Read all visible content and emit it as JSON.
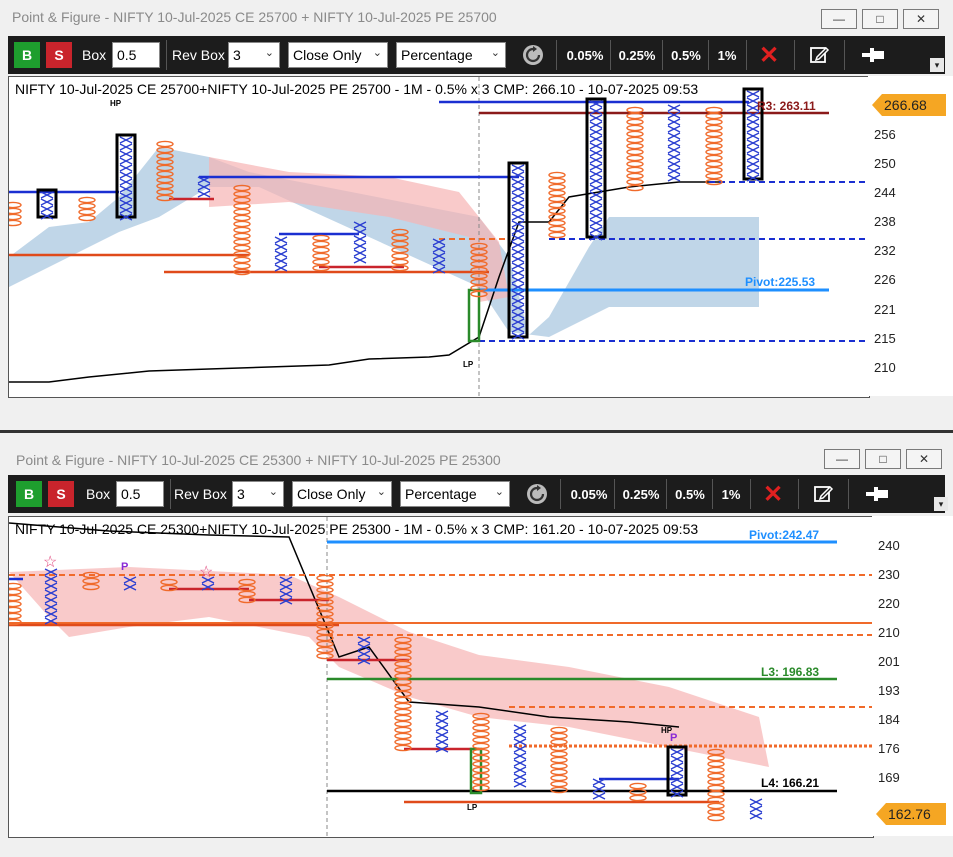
{
  "windows": [
    {
      "title": "Point & Figure - NIFTY 10-Jul-2025 CE 25700 + NIFTY 10-Jul-2025 PE 25700",
      "toolbar": {
        "buy": "B",
        "sell": "S",
        "box_label": "Box",
        "box_value": "0.5",
        "rev_label": "Rev Box",
        "rev_value": "3",
        "mode": "Close Only",
        "method": "Percentage",
        "pcts": [
          "0.05%",
          "0.25%",
          "0.5%",
          "1%"
        ]
      },
      "caption": "NIFTY 10-Jul-2025 CE 25700+NIFTY 10-Jul-2025 PE 25700 - 1M - 0.5% x 3 CMP: 266.10 - 10-07-2025 09:53",
      "cmp_tag": "266.68",
      "ticks": [
        "256",
        "250",
        "244",
        "238",
        "232",
        "226",
        "221",
        "215",
        "210"
      ],
      "levels": {
        "r3": "R3: 263.11",
        "pivot": "Pivot:225.53"
      },
      "markers": {
        "hp": "HP",
        "lp": "LP"
      }
    },
    {
      "title": "Point & Figure - NIFTY 10-Jul-2025 CE 25300 + NIFTY 10-Jul-2025 PE 25300",
      "toolbar": {
        "buy": "B",
        "sell": "S",
        "box_label": "Box",
        "box_value": "0.5",
        "rev_label": "Rev Box",
        "rev_value": "3",
        "mode": "Close Only",
        "method": "Percentage",
        "pcts": [
          "0.05%",
          "0.25%",
          "0.5%",
          "1%"
        ]
      },
      "caption": "NIFTY 10-Jul-2025 CE 25300+NIFTY 10-Jul-2025 PE 25300 - 1M - 0.5% x 3 CMP: 161.20 - 10-07-2025 09:53",
      "cmp_tag": "162.76",
      "ticks": [
        "240",
        "230",
        "220",
        "210",
        "201",
        "193",
        "184",
        "176",
        "169"
      ],
      "levels": {
        "pivot": "Pivot:242.47",
        "l3": "L3: 196.83",
        "l4": "L4: 166.21"
      },
      "markers": {
        "hp": "HP",
        "lp": "LP",
        "p1": "P",
        "p2": "P"
      }
    }
  ],
  "colors": {
    "buy": "#1e9e2e",
    "sell": "#c9242c",
    "cmp": "#f5a623",
    "x_col": "#2b3fd1",
    "o_col": "#f06a2a"
  },
  "icons": [
    "refresh-icon",
    "close-red-icon",
    "edit-icon",
    "pin-icon",
    "minimize-icon",
    "maximize-icon",
    "close-window-icon"
  ]
}
